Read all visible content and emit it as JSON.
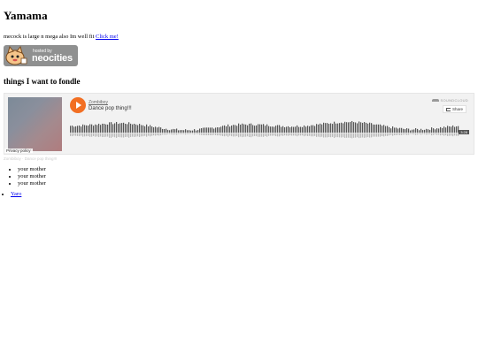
{
  "page": {
    "title": "Yamama",
    "tagline_text": "mecock is large n mega also Im well fit ",
    "tagline_link": "Click me!",
    "section_heading": "things I want to fondle"
  },
  "badge": {
    "line1": "hosted by",
    "line2": "neocities"
  },
  "player": {
    "artist": "Zombiboy",
    "track": "Dance pop thing!!!",
    "brand": "SOUNDCLOUD",
    "share_label": "Share",
    "duration": "3:28",
    "privacy": "Privacy policy",
    "accent_color": "#f26f23",
    "played_fraction": 0
  },
  "caption": "Zombiboy · Dance pop thing!!!",
  "list": {
    "items": [
      "your mother",
      "your mother",
      "your mother"
    ]
  },
  "links": {
    "items": [
      "Yaro"
    ]
  }
}
